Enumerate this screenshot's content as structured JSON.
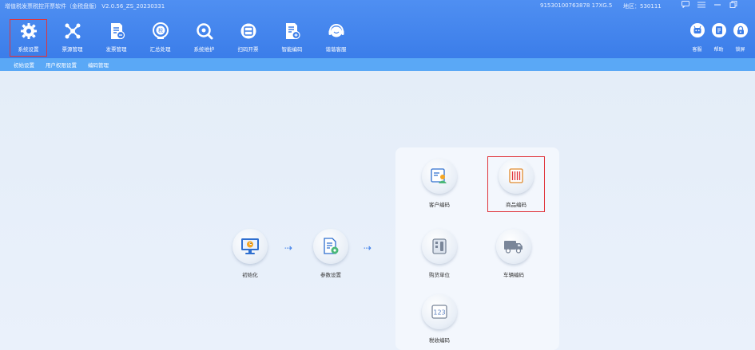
{
  "titlebar": {
    "app_title": "增值税发票税控开票软件（金税盘版） V2.0.56_ZS_20230331",
    "tax_id": "91530100763878 17XG.5",
    "region": "地区：530111"
  },
  "window_controls": [
    "chat-icon",
    "menu-icon",
    "minimize-icon",
    "restore-icon"
  ],
  "nav": {
    "items": [
      {
        "label": "系统设置",
        "icon": "gear-icon"
      },
      {
        "label": "票源管理",
        "icon": "nodes-icon"
      },
      {
        "label": "发票管理",
        "icon": "invoice-icon"
      },
      {
        "label": "汇总处理",
        "icon": "summary-icon"
      },
      {
        "label": "系统维护",
        "icon": "maintenance-icon"
      },
      {
        "label": "扫码开票",
        "icon": "scan-icon"
      },
      {
        "label": "智能编码",
        "icon": "smart-code-icon"
      },
      {
        "label": "谐谐客服",
        "icon": "service-icon"
      }
    ],
    "active_index": 0
  },
  "right_tools": [
    {
      "label": "客服",
      "icon": "robot-icon"
    },
    {
      "label": "帮助",
      "icon": "help-icon"
    },
    {
      "label": "锁屏",
      "icon": "lock-icon"
    }
  ],
  "subtabs": [
    "初始设置",
    "用户权限设置",
    "编码管理"
  ],
  "flow": {
    "init": "初始化",
    "params": "参数设置",
    "arrow": "⇢"
  },
  "panel": {
    "customer_code": "客户编码",
    "goods_code": "商品编码",
    "buyer_unit": "购货单位",
    "vehicle_code": "车辆编码",
    "tax_code": "税收编码"
  },
  "colors": {
    "header_blue": "#3b7de9",
    "subbar_blue": "#5aa8f6",
    "highlight_red": "#e0353b",
    "main_bg": "#e6eef9"
  }
}
